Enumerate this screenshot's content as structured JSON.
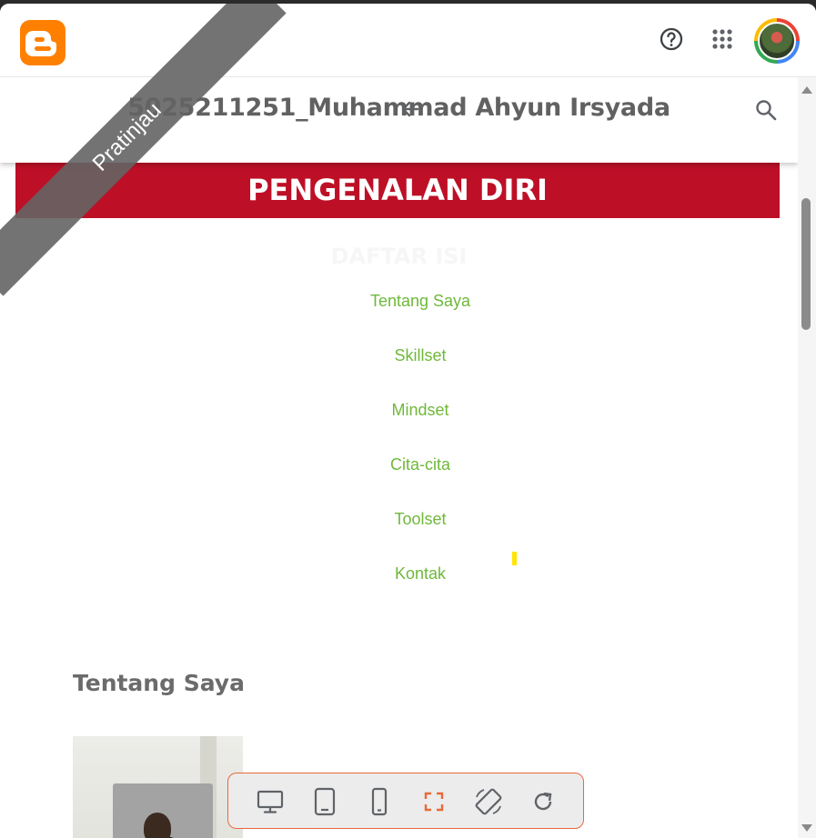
{
  "appbar": {
    "logo_icon": "blogger-logo-icon",
    "help_icon": "help-circle-icon",
    "apps_icon": "apps-grid-icon",
    "avatar_icon": "account-avatar"
  },
  "blog": {
    "title": "5025211251_Muhammad Ahyun Irsyada",
    "banner": "PENGENALAN DIRI",
    "toc_title": "DAFTAR ISI",
    "toc_items": [
      {
        "label": "Tentang Saya"
      },
      {
        "label": "Skillset"
      },
      {
        "label": "Mindset"
      },
      {
        "label": "Cita-cita"
      },
      {
        "label": "Toolset"
      },
      {
        "label": "Kontak"
      }
    ],
    "section_heading": "Tentang Saya"
  },
  "ribbon": {
    "label": "Pratinjau"
  },
  "colors": {
    "brand_orange": "#ff8000",
    "banner_red": "#bd1027",
    "link_green": "#6fb83a",
    "toolbar_accent": "#e8693a"
  },
  "device_toolbar": {
    "buttons": [
      "desktop-icon",
      "tablet-icon",
      "phone-icon",
      "fullscreen-icon",
      "rotate-icon",
      "refresh-icon"
    ]
  }
}
